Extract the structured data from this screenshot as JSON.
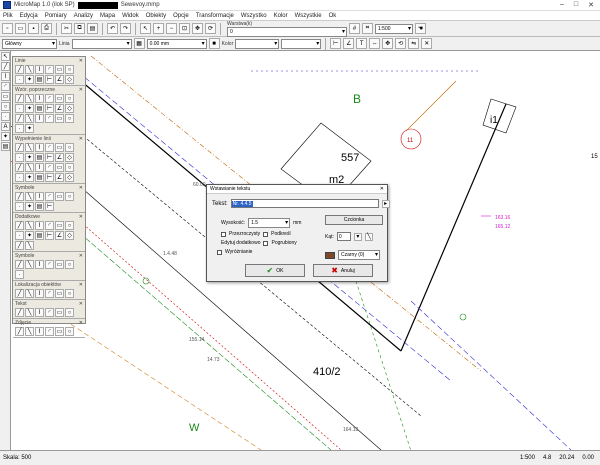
{
  "window": {
    "title_prefix": "MicroMap 1.0 (ilok SP)",
    "title_suffix": "Sewevoy.mmp",
    "controls": [
      "–",
      "□",
      "✕"
    ]
  },
  "menu": [
    "Plik",
    "Edycja",
    "Pomiary",
    "Analizy",
    "Mapa",
    "Widok",
    "Obiekty",
    "Opcje",
    "Transformacje",
    "Wszystko",
    "Kolor",
    "Wszystkie",
    "Ok"
  ],
  "toolbar1": {
    "scale_combo": "",
    "layer_label": "Warstwa(k)",
    "layer_value": "0",
    "zoom_value": "1:500"
  },
  "toolbar2": {
    "layer_combo": "Główny",
    "line_label": "Linia",
    "width_value": "0.00 mm",
    "color_label": "Kolor"
  },
  "panel": {
    "sections": [
      {
        "title": "Linie",
        "count": 12
      },
      {
        "title": "Wzór. poprzeczne",
        "count": 20
      },
      {
        "title": "Wypełnienie linii",
        "count": 24
      },
      {
        "title": "Symbole",
        "count": 10
      },
      {
        "title": "Dodatkowe",
        "count": 14
      },
      {
        "title": "Symbole",
        "count": 7
      },
      {
        "title": "Lokalizacja obiektów",
        "count": 6
      },
      {
        "title": "Tekst",
        "count": 6
      },
      {
        "title": "Zdjęcie",
        "count": 6
      }
    ]
  },
  "map": {
    "labels": [
      {
        "text": "B",
        "color": "#1a8a1a"
      },
      {
        "text": "557",
        "color": "#000"
      },
      {
        "text": "m2",
        "color": "#000"
      },
      {
        "text": "i1",
        "color": "#000"
      },
      {
        "text": "15",
        "color": "#000"
      },
      {
        "text": "410/2",
        "color": "#000"
      },
      {
        "text": "W",
        "color": "#1a8a1a"
      },
      {
        "text": "11",
        "color": "#c00"
      },
      {
        "text": "1.4.48",
        "color": "#555"
      },
      {
        "text": "14.73",
        "color": "#555"
      },
      {
        "text": "155.14",
        "color": "#555"
      },
      {
        "text": "164.18",
        "color": "#555"
      },
      {
        "text": "163.16",
        "color": "#d020d0"
      },
      {
        "text": "165.12",
        "color": "#d020d0"
      },
      {
        "text": "60.00",
        "color": "#555"
      }
    ]
  },
  "dialog": {
    "title": "Wstawianie tekstu",
    "text_label": "Tekst:",
    "text_value": "Nr. 4.4.5",
    "size_label": "Wysokość:",
    "size_value": "1.5",
    "unit": "mm",
    "angle_label": "Kąt:",
    "angle_value": "0",
    "opts": [
      "Przezroczysty",
      "Podkreśl",
      "Edytuj dodatkowo",
      "Pogrubiony",
      "Wyróżnianie"
    ],
    "font_button": "Czcionka",
    "color_label": "Czarny (0)",
    "ok_label": "OK",
    "cancel_label": "Anuluj"
  },
  "status": {
    "left": "Skala: 500",
    "right": [
      "1:500",
      "4.8",
      "20.24",
      "0.00"
    ]
  }
}
